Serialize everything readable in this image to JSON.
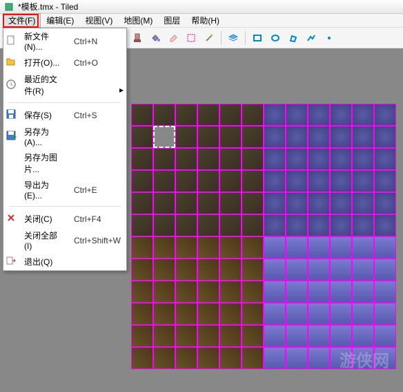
{
  "window": {
    "title": "*模板.tmx - Tiled"
  },
  "menubar": {
    "items": [
      {
        "label": "文件(F)"
      },
      {
        "label": "编辑(E)"
      },
      {
        "label": "视图(V)"
      },
      {
        "label": "地图(M)"
      },
      {
        "label": "图层"
      },
      {
        "label": "帮助(H)"
      }
    ]
  },
  "file_menu": {
    "groups": [
      [
        {
          "icon": "new-icon",
          "label": "新文件(N)...",
          "shortcut": "Ctrl+N"
        },
        {
          "icon": "open-icon",
          "label": "打开(O)...",
          "shortcut": "Ctrl+O"
        },
        {
          "icon": "recent-icon",
          "label": "最近的文件(R)",
          "shortcut": "",
          "submenu": true
        }
      ],
      [
        {
          "icon": "save-icon",
          "label": "保存(S)",
          "shortcut": "Ctrl+S"
        },
        {
          "icon": "saveas-icon",
          "label": "另存为(A)...",
          "shortcut": ""
        },
        {
          "icon": "",
          "label": "另存为图片...",
          "shortcut": ""
        },
        {
          "icon": "",
          "label": "导出为(E)...",
          "shortcut": "Ctrl+E"
        }
      ],
      [
        {
          "icon": "close-icon",
          "label": "关闭(C)",
          "shortcut": "Ctrl+F4"
        },
        {
          "icon": "",
          "label": "关闭全部(I)",
          "shortcut": "Ctrl+Shift+W"
        },
        {
          "icon": "exit-icon",
          "label": "退出(Q)",
          "shortcut": ""
        }
      ]
    ]
  },
  "toolbar_icons": [
    "new-icon",
    "open-icon",
    "save-icon",
    "sep",
    "undo-icon",
    "redo-icon",
    "sep",
    "cmd-icon",
    "sep",
    "stamp-icon",
    "fill-icon",
    "eraser-icon",
    "select-icon",
    "wand-icon",
    "sep",
    "layers-icon",
    "sep",
    "rect-icon",
    "circle-icon",
    "poly-icon",
    "line-icon",
    "point-icon"
  ],
  "watermark": "游侠网"
}
